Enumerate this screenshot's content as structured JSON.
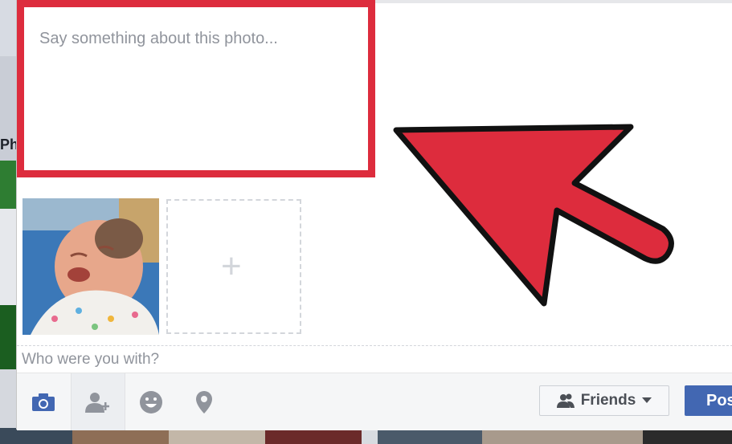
{
  "status": {
    "placeholder": "Say something about this photo..."
  },
  "background": {
    "left_text": "Ph"
  },
  "tagging": {
    "who_placeholder": "Who were you with?"
  },
  "add_photo": {
    "symbol": "+"
  },
  "toolbar": {
    "icons": [
      "camera-icon",
      "tag-people-icon",
      "feeling-icon",
      "location-icon"
    ],
    "audience_label": "Friends",
    "post_label": "Post"
  },
  "colors": {
    "highlight_red": "#dd2c3d",
    "facebook_blue": "#4267b2"
  }
}
